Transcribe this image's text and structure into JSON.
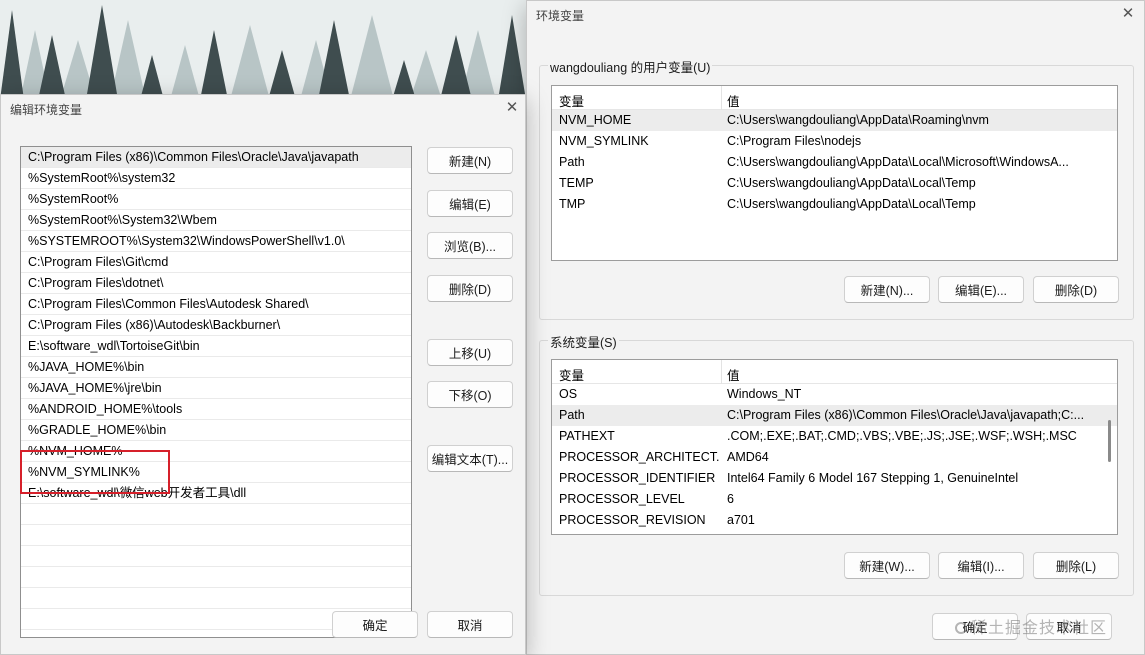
{
  "edit_window": {
    "title": "编辑环境变量",
    "paths": [
      "C:\\Program Files (x86)\\Common Files\\Oracle\\Java\\javapath",
      "%SystemRoot%\\system32",
      "%SystemRoot%",
      "%SystemRoot%\\System32\\Wbem",
      "%SYSTEMROOT%\\System32\\WindowsPowerShell\\v1.0\\",
      "C:\\Program Files\\Git\\cmd",
      "C:\\Program Files\\dotnet\\",
      "C:\\Program Files\\Common Files\\Autodesk Shared\\",
      "C:\\Program Files (x86)\\Autodesk\\Backburner\\",
      "E:\\software_wdl\\TortoiseGit\\bin",
      "%JAVA_HOME%\\bin",
      "%JAVA_HOME%\\jre\\bin",
      "%ANDROID_HOME%\\tools",
      "%GRADLE_HOME%\\bin",
      "%NVM_HOME%",
      "%NVM_SYMLINK%",
      "E:\\software_wdl\\微信web开发者工具\\dll"
    ],
    "buttons": {
      "new": "新建(N)",
      "edit": "编辑(E)",
      "browse": "浏览(B)...",
      "delete": "删除(D)",
      "move_up": "上移(U)",
      "move_down": "下移(O)",
      "edit_text": "编辑文本(T)...",
      "ok": "确定",
      "cancel": "取消"
    }
  },
  "env_window": {
    "title": "环境变量",
    "user_group_label": "wangdouliang 的用户变量(U)",
    "system_group_label": "系统变量(S)",
    "col_var": "变量",
    "col_val": "值",
    "user_vars": [
      {
        "name": "NVM_HOME",
        "value": "C:\\Users\\wangdouliang\\AppData\\Roaming\\nvm"
      },
      {
        "name": "NVM_SYMLINK",
        "value": "C:\\Program Files\\nodejs"
      },
      {
        "name": "Path",
        "value": "C:\\Users\\wangdouliang\\AppData\\Local\\Microsoft\\WindowsA..."
      },
      {
        "name": "TEMP",
        "value": "C:\\Users\\wangdouliang\\AppData\\Local\\Temp"
      },
      {
        "name": "TMP",
        "value": "C:\\Users\\wangdouliang\\AppData\\Local\\Temp"
      }
    ],
    "system_vars": [
      {
        "name": "OS",
        "value": "Windows_NT"
      },
      {
        "name": "Path",
        "value": "C:\\Program Files (x86)\\Common Files\\Oracle\\Java\\javapath;C:..."
      },
      {
        "name": "PATHEXT",
        "value": ".COM;.EXE;.BAT;.CMD;.VBS;.VBE;.JS;.JSE;.WSF;.WSH;.MSC"
      },
      {
        "name": "PROCESSOR_ARCHITECT...",
        "value": "AMD64"
      },
      {
        "name": "PROCESSOR_IDENTIFIER",
        "value": "Intel64 Family 6 Model 167 Stepping 1, GenuineIntel"
      },
      {
        "name": "PROCESSOR_LEVEL",
        "value": "6"
      },
      {
        "name": "PROCESSOR_REVISION",
        "value": "a701"
      }
    ],
    "user_buttons": {
      "new": "新建(N)...",
      "edit": "编辑(E)...",
      "delete": "删除(D)"
    },
    "system_buttons": {
      "new": "新建(W)...",
      "edit": "编辑(I)...",
      "delete": "删除(L)"
    },
    "ok": "确定",
    "cancel": "取消"
  },
  "watermark": "稀土掘金技术社区",
  "colors": {
    "highlight_box": "#d6202a",
    "selection": "#ececec"
  }
}
